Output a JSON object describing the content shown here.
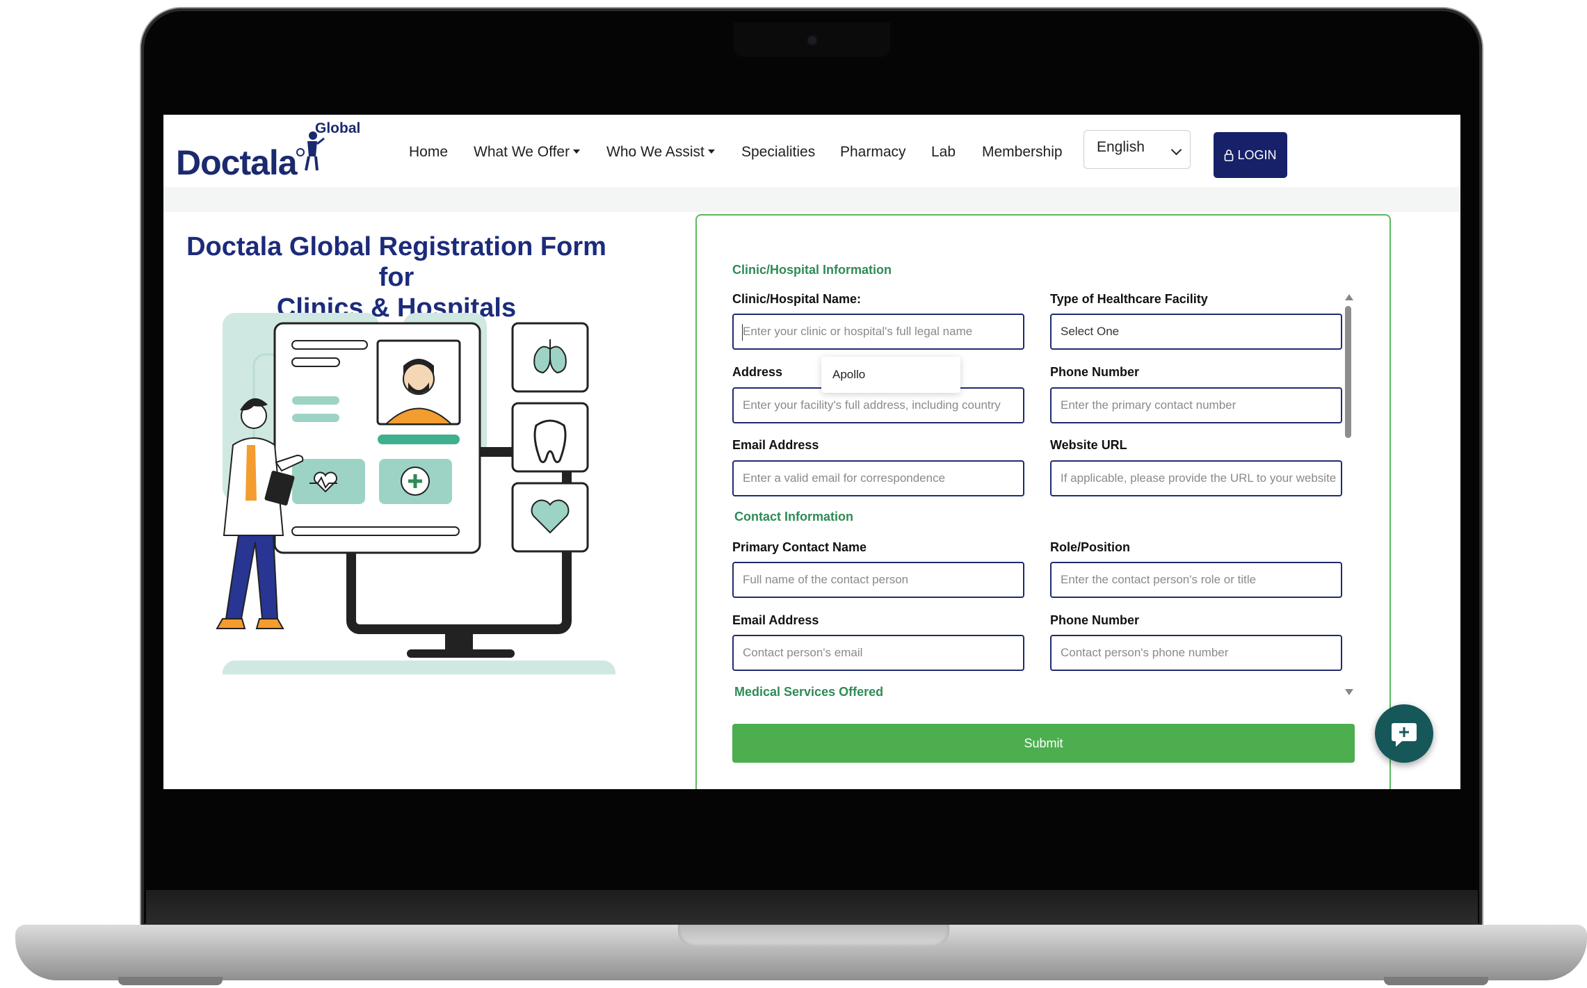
{
  "brand": {
    "name": "Doctala",
    "sub": "Global"
  },
  "nav": {
    "items": [
      {
        "label": "Home",
        "dropdown": false
      },
      {
        "label": "What We Offer",
        "dropdown": true
      },
      {
        "label": "Who We Assist",
        "dropdown": true
      },
      {
        "label": "Specialities",
        "dropdown": false
      },
      {
        "label": "Pharmacy",
        "dropdown": false
      },
      {
        "label": "Lab",
        "dropdown": false
      },
      {
        "label": "Membership",
        "dropdown": false
      }
    ],
    "language": "English",
    "login_label": "LOGIN"
  },
  "page": {
    "title_line1": "Doctala Global Registration Form for",
    "title_line2": "Clinics & Hospitals"
  },
  "form": {
    "section_clinic": "Clinic/Hospital Information",
    "clinic_name_label": "Clinic/Hospital Name:",
    "clinic_name_placeholder": "Enter your clinic or hospital's full legal name",
    "facility_type_label": "Type of Healthcare Facility",
    "facility_type_value": "Select One",
    "address_label": "Address",
    "address_placeholder": "Enter your facility's full address, including country",
    "phone_label": "Phone Number",
    "phone_placeholder": "Enter the primary contact number",
    "email_label": "Email Address",
    "email_placeholder": "Enter a valid email for correspondence",
    "website_label": "Website URL",
    "website_placeholder": "If applicable, please provide the URL to your website",
    "autocomplete_suggestion": "Apollo",
    "section_contact": "Contact Information",
    "contact_name_label": "Primary Contact Name",
    "contact_name_placeholder": "Full name of the contact person",
    "role_label": "Role/Position",
    "role_placeholder": "Enter the contact person's role or title",
    "contact_email_label": "Email Address",
    "contact_email_placeholder": "Contact person's email",
    "contact_phone_label": "Phone Number",
    "contact_phone_placeholder": "Contact person's phone number",
    "section_services": "Medical Services Offered",
    "submit_label": "Submit"
  },
  "colors": {
    "brand_navy": "#1b2a6e",
    "accent_green": "#4cae4f",
    "section_green": "#2e8b57",
    "illustration_mint": "#9dd3c5"
  }
}
